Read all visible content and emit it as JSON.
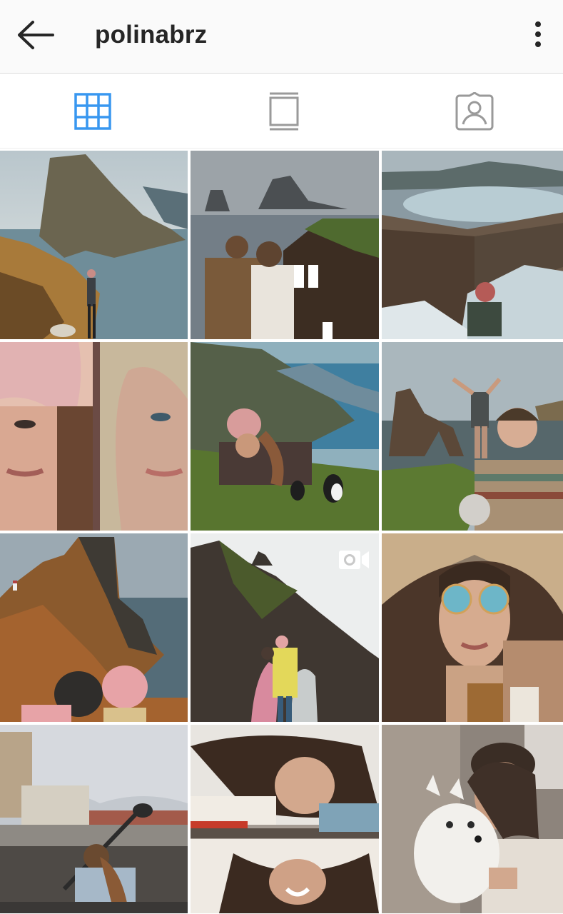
{
  "header": {
    "username": "polinabrz",
    "back_icon": "back-arrow-icon",
    "menu_icon": "more-vertical-icon"
  },
  "tabs": [
    {
      "name": "grid",
      "icon": "grid-icon",
      "active": true
    },
    {
      "name": "feed",
      "icon": "feed-list-icon",
      "active": false
    },
    {
      "name": "tagged",
      "icon": "tagged-person-icon",
      "active": false
    }
  ],
  "colors": {
    "accent": "#3897f0",
    "inactive_icon": "#9a9a9a",
    "text": "#262626",
    "header_bg": "#fafafa"
  },
  "posts": [
    {
      "name": "cliff-sea-stack-woman",
      "video": false
    },
    {
      "name": "couple-turf-house",
      "video": false
    },
    {
      "name": "cliff-waves-beanie",
      "video": false
    },
    {
      "name": "closeup-two-faces",
      "video": false
    },
    {
      "name": "woman-lying-puffin",
      "video": false
    },
    {
      "name": "selfie-sea-stack-arch",
      "video": false
    },
    {
      "name": "lighthouse-cliff-couple",
      "video": false
    },
    {
      "name": "couple-under-cliff-arch",
      "video": true
    },
    {
      "name": "sunglasses-straw-hat",
      "video": false
    },
    {
      "name": "kayak-city-canal",
      "video": false
    },
    {
      "name": "mirror-reflection-portrait",
      "video": false
    },
    {
      "name": "woman-with-white-dog",
      "video": false
    }
  ]
}
